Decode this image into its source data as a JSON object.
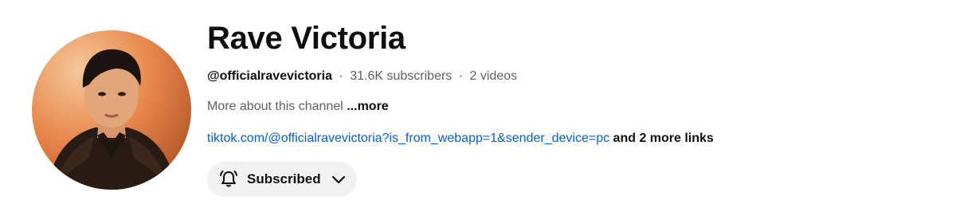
{
  "channel": {
    "name": "Rave Victoria",
    "handle": "@officialravevictoria",
    "separator": "·",
    "subscribers": "31.6K subscribers",
    "videos": "2 videos",
    "about_label": "More about this channel",
    "more_label": "...more",
    "link_text": "tiktok.com/@officialravevictoria?is_from_webapp=1&sender_device=pc",
    "more_links_label": "and 2 more links"
  },
  "subscribe_button": {
    "label": "Subscribed",
    "icon": "bell-icon",
    "dropdown_icon": "chevron-down-icon"
  },
  "colors": {
    "text_primary": "#0f0f0f",
    "text_secondary": "#606060",
    "link": "#065fd4",
    "button_bg": "#f2f2f2"
  }
}
